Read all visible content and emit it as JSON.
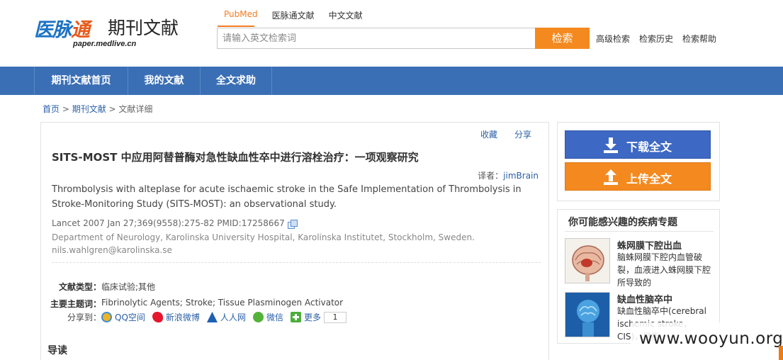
{
  "header": {
    "logo_mark_main": "医脉",
    "logo_mark_accent": "通",
    "logo_text": "期刊文献",
    "logo_url": "paper.medlive.cn",
    "search_tabs": [
      "PubMed",
      "医脉通文献",
      "中文文献"
    ],
    "search_placeholder": "请输入英文检索词",
    "search_button": "检索",
    "links": [
      "高级检索",
      "检索历史",
      "检索帮助"
    ]
  },
  "nav": {
    "items": [
      "期刊文献首页",
      "我的文献",
      "全文求助"
    ]
  },
  "breadcrumb": {
    "home": "首页",
    "sep1": " > ",
    "section": "期刊文献",
    "sep2": " > ",
    "current": "文献详细"
  },
  "article": {
    "actions": [
      "收藏",
      "分享"
    ],
    "title_cn": "SITS-MOST 中应用阿替普酶对急性缺血性卒中进行溶栓治疗：一项观察研究",
    "translator_label": "译者：",
    "translator_name": "jimBrain",
    "title_en": "Thrombolysis with alteplase for acute ischaemic stroke in the Safe Implementation of Thrombolysis in Stroke-Monitoring Study (SITS-MOST): an observational study.",
    "citation": "Lancet 2007 Jan 27;369(9558):275-82 PMID:17258667",
    "affiliation": "Department of Neurology, Karolinska University Hospital, Karolinska Institutet, Stockholm, Sweden.",
    "email": "nils.wahlgren@karolinska.se",
    "doc_type_label": "文献类型：",
    "doc_type_value": "临床试验;其他",
    "topics_label": "主要主题词：",
    "topics_value": "Fibrinolytic Agents; Stroke; Tissue Plasminogen Activator",
    "share_label": "分享到：",
    "share_items": [
      "QQ空间",
      "新浪微博",
      "人人网",
      "微信",
      "更多"
    ],
    "share_count": "1",
    "guide_heading": "导读"
  },
  "sidebar": {
    "download_label": "下载全文",
    "upload_label": "上传全文",
    "topics_title": "你可能感兴趣的疾病专题",
    "topics": [
      {
        "name": "蛛网膜下腔出血",
        "desc": "脑蛛网膜下腔内血管破裂，血液进入蛛网膜下腔所导致的"
      },
      {
        "name": "缺血性脑卒中",
        "desc": "缺血性脑卒中(cerebral ischemic stroke，CIS)，是指"
      }
    ]
  },
  "watermark": "www.wooyun.org",
  "colors": {
    "nav_bg": "#3a6fb5",
    "accent_orange": "#f48a1f",
    "download_blue": "#3d69c4",
    "link_blue": "#2a5fa8"
  }
}
